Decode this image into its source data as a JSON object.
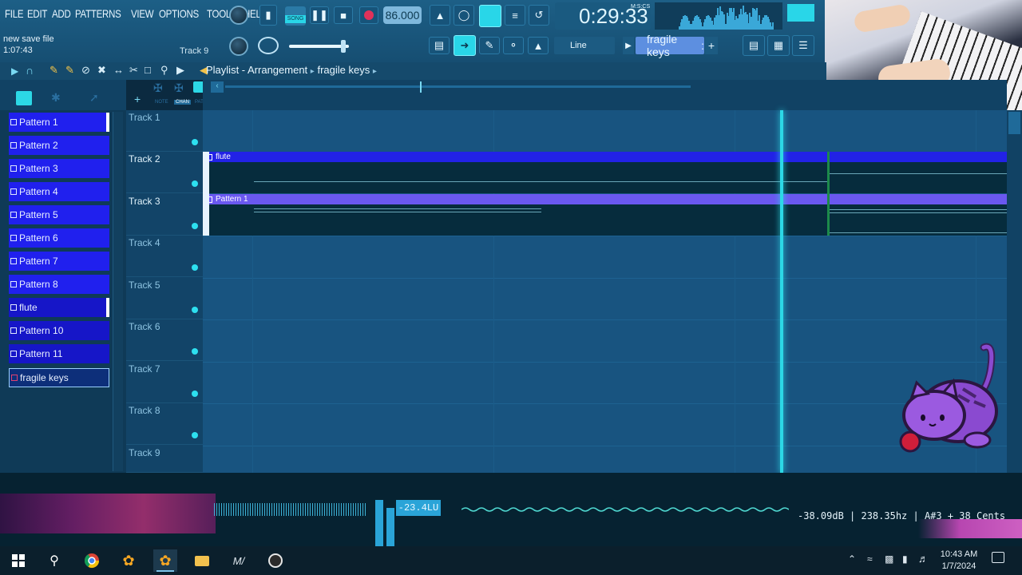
{
  "menu": [
    "FILE",
    "EDIT",
    "ADD",
    "PATTERNS",
    "VIEW",
    "OPTIONS",
    "TOOLS",
    "HELP"
  ],
  "hint": {
    "line1": "new save file",
    "line2": "1:07:43",
    "track": "Track 9"
  },
  "transport": {
    "song_label": "SONG",
    "tempo": "86.000",
    "time": "0:29:33",
    "time_unit": "M:S:CS"
  },
  "toolbar": {
    "snap": "Line",
    "pattern": "fragile keys",
    "pattern_suffix": ":",
    "add": "+"
  },
  "playlist": {
    "title": "Playlist - Arrangement",
    "pattern": "fragile keys",
    "sep": "▸",
    "toggles": [
      "NOTE",
      "CHAN",
      "PAT"
    ]
  },
  "patterns": [
    "Pattern 1",
    "Pattern 2",
    "Pattern 3",
    "Pattern 4",
    "Pattern 5",
    "Pattern 6",
    "Pattern 7",
    "Pattern 8",
    "flute",
    "Pattern 10",
    "Pattern 11",
    "fragile keys"
  ],
  "tracks": [
    "Track 1",
    "Track 2",
    "Track 3",
    "Track 4",
    "Track 5",
    "Track 6",
    "Track 7",
    "Track 8",
    "Track 9"
  ],
  "clips": {
    "flute": "flute",
    "pattern1": "Pattern 1"
  },
  "viz": {
    "lufs": "-23.4LU",
    "readout": "-38.09dB | 238.35hz | A#3 + 38 Cents"
  },
  "clock": {
    "time": "10:43 AM",
    "date": "1/7/2024"
  },
  "colors": {
    "accent": "#29d6e8",
    "pattern": "#2020ee",
    "clip_flute": "#2222e6",
    "clip_pattern1": "#6a58f0"
  },
  "icons": [
    "windows-icon",
    "search-icon",
    "chrome-icon",
    "fl-studio-icon",
    "fl-studio-active-icon",
    "folder-icon",
    "musescore-icon",
    "obs-icon"
  ]
}
